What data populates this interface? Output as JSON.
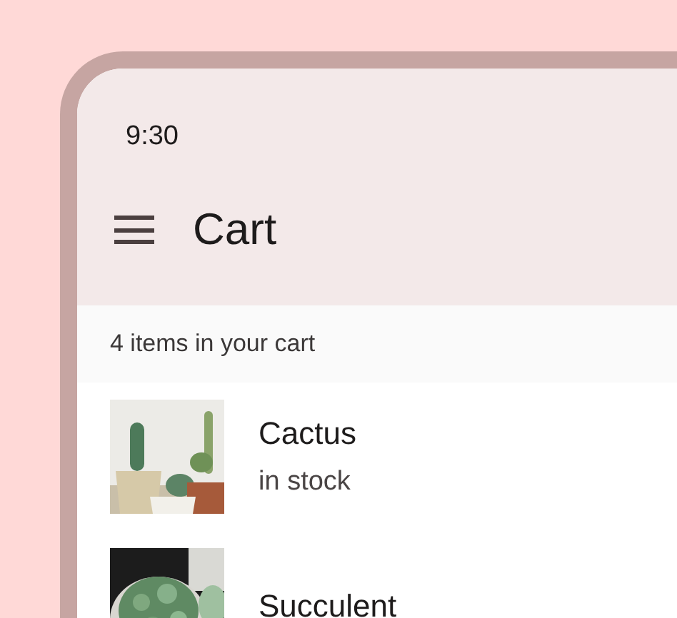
{
  "status_bar": {
    "time": "9:30"
  },
  "app_bar": {
    "title": "Cart"
  },
  "summary": "4 items in your cart",
  "items": [
    {
      "name": "Cactus",
      "status": "in stock",
      "kind": "picture"
    },
    {
      "name": "Succulent",
      "kind": "picture"
    }
  ]
}
